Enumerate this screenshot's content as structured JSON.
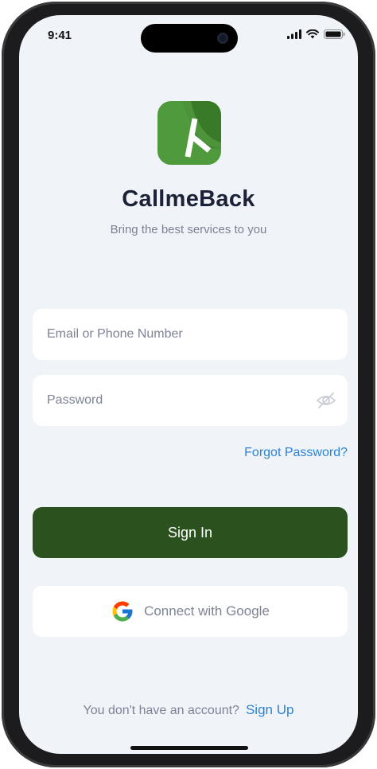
{
  "status_bar": {
    "time": "9:41",
    "icons": [
      "signal-icon",
      "wifi-icon",
      "battery-icon"
    ]
  },
  "app": {
    "name": "CallmeBack",
    "tagline": "Bring the best services to you",
    "logo_icon": "app-logo-icon"
  },
  "form": {
    "email_placeholder": "Email or Phone Number",
    "email_value": "",
    "password_placeholder": "Password",
    "password_value": "",
    "visibility_icon": "eye-off-icon",
    "forgot_label": "Forgot Password?",
    "signin_label": "Sign In",
    "google_label": "Connect with Google",
    "google_icon": "google-icon"
  },
  "footer": {
    "question": "You don't have an account?",
    "signup_label": "Sign Up"
  },
  "colors": {
    "primary": "#2b521e",
    "link": "#2a83d6",
    "background": "#f0f4f9",
    "logo_green": "#4e9a3c"
  }
}
